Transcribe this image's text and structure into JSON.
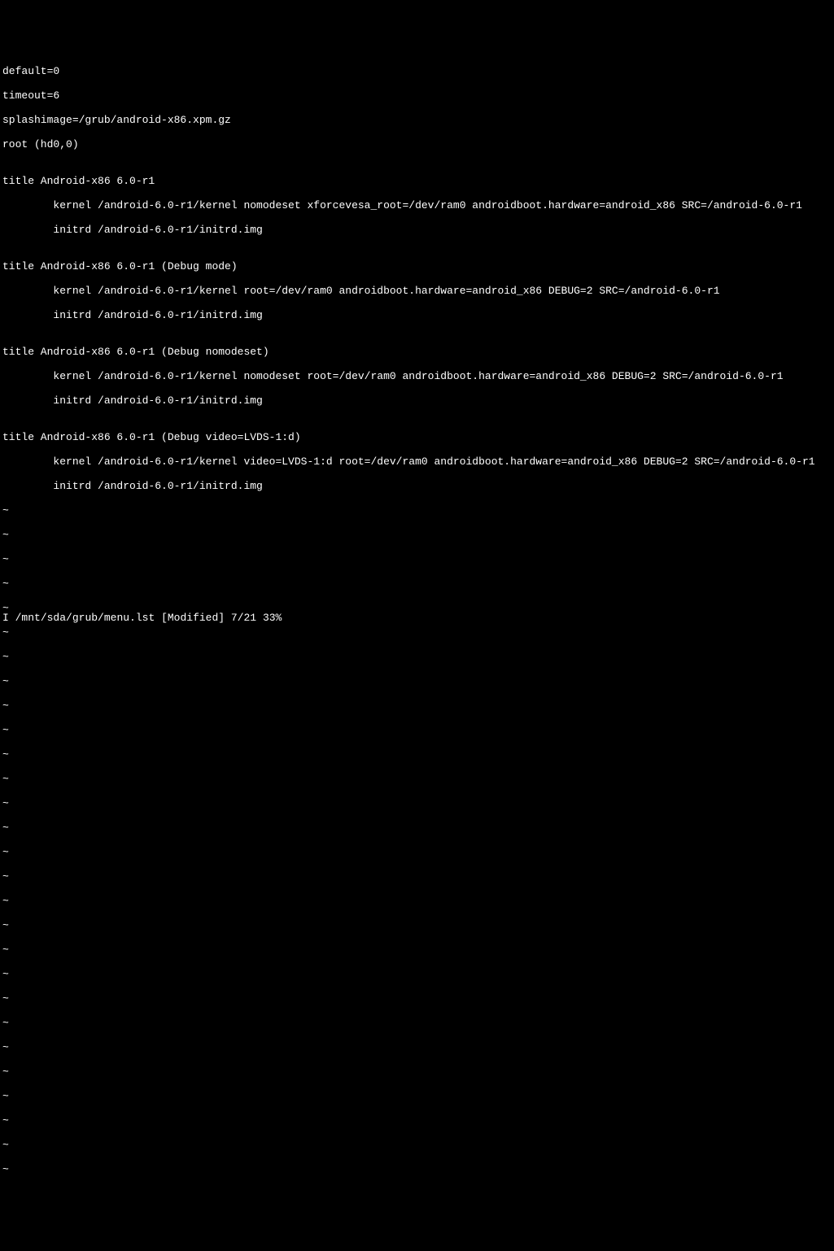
{
  "file_content": {
    "lines": [
      "default=0",
      "timeout=6",
      "splashimage=/grub/android-x86.xpm.gz",
      "root (hd0,0)",
      "",
      "title Android-x86 6.0-r1",
      "        kernel /android-6.0-r1/kernel nomodeset xforcevesa_root=/dev/ram0 androidboot.hardware=android_x86 SRC=/android-6.0-r1",
      "        initrd /android-6.0-r1/initrd.img",
      "",
      "title Android-x86 6.0-r1 (Debug mode)",
      "        kernel /android-6.0-r1/kernel root=/dev/ram0 androidboot.hardware=android_x86 DEBUG=2 SRC=/android-6.0-r1",
      "        initrd /android-6.0-r1/initrd.img",
      "",
      "title Android-x86 6.0-r1 (Debug nomodeset)",
      "        kernel /android-6.0-r1/kernel nomodeset root=/dev/ram0 androidboot.hardware=android_x86 DEBUG=2 SRC=/android-6.0-r1",
      "        initrd /android-6.0-r1/initrd.img",
      "",
      "title Android-x86 6.0-r1 (Debug video=LVDS-1:d)",
      "        kernel /android-6.0-r1/kernel video=LVDS-1:d root=/dev/ram0 androidboot.hardware=android_x86 DEBUG=2 SRC=/android-6.0-r1",
      "        initrd /android-6.0-r1/initrd.img"
    ]
  },
  "empty_lines": {
    "tilde": "~",
    "count": 20
  },
  "status": {
    "mode": "I",
    "file_path": "/mnt/sda/grub/menu.lst",
    "modified_flag": "[Modified]",
    "position": "7/21",
    "percent": "33%"
  }
}
